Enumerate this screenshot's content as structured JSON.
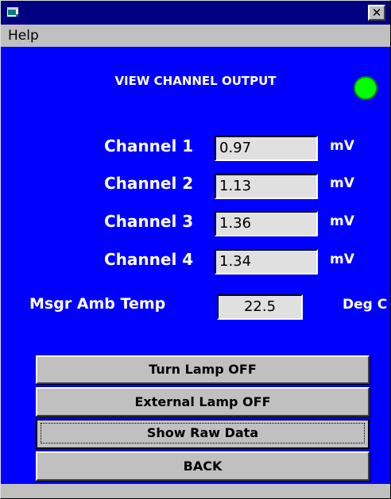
{
  "window": {
    "close_label": "✕"
  },
  "menu": {
    "help": "Help"
  },
  "panel": {
    "title": "VIEW CHANNEL OUTPUT",
    "status_color": "#00ff00",
    "channels": [
      {
        "label": "Channel 1",
        "value": "0.97",
        "unit": "mV"
      },
      {
        "label": "Channel 2",
        "value": "1.13",
        "unit": "mV"
      },
      {
        "label": "Channel 3",
        "value": "1.36",
        "unit": "mV"
      },
      {
        "label": "Channel 4",
        "value": "1.34",
        "unit": "mV"
      }
    ],
    "temp": {
      "label": "Msgr Amb Temp",
      "value": "22.5",
      "unit": "Deg C"
    }
  },
  "buttons": {
    "turn_lamp": "Turn Lamp OFF",
    "external_lamp": "External Lamp OFF",
    "show_raw": "Show Raw Data",
    "back": "BACK"
  }
}
